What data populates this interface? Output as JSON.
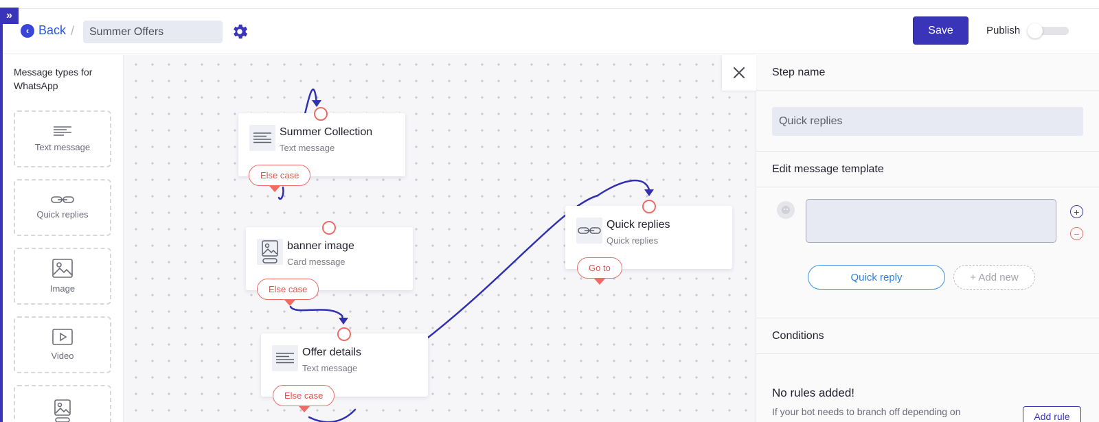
{
  "header": {
    "back_label": "Back",
    "separator": "/",
    "flow_name": "Summer Offers",
    "save_label": "Save",
    "publish_label": "Publish",
    "publish_enabled": false
  },
  "palette": {
    "title": "Message types for WhatsApp",
    "items": [
      {
        "label": "Text message",
        "icon": "text-lines-icon"
      },
      {
        "label": "Quick replies",
        "icon": "link-chain-icon"
      },
      {
        "label": "Image",
        "icon": "image-icon"
      },
      {
        "label": "Video",
        "icon": "video-play-icon"
      },
      {
        "label": "",
        "icon": "card-image-icon"
      }
    ]
  },
  "canvas": {
    "nodes": [
      {
        "title": "Summer Collection",
        "subtitle": "Text message",
        "case_label": "Else case",
        "icon": "text-lines-icon"
      },
      {
        "title": "banner image",
        "subtitle": "Card message",
        "case_label": "Else case",
        "icon": "card-image-icon"
      },
      {
        "title": "Offer details",
        "subtitle": "Text message",
        "case_label": "Else case",
        "icon": "text-lines-icon"
      },
      {
        "title": "Quick replies",
        "subtitle": "Quick replies",
        "case_label": "Go to",
        "icon": "link-chain-icon"
      }
    ]
  },
  "panel": {
    "step_name_heading": "Step name",
    "step_name_value": "Quick replies",
    "template_heading": "Edit message template",
    "template_text": "",
    "quick_reply_label": "Quick reply",
    "add_new_label": "+ Add new",
    "conditions_heading": "Conditions",
    "no_rules_title": "No rules added!",
    "no_rules_hint": "If your bot needs to branch off depending on",
    "add_rule_label": "Add rule"
  },
  "colors": {
    "primary": "#3a35b8",
    "accent_red": "#ee6b66",
    "link_blue": "#2b56e0",
    "canvas_bg": "#f6f6f9"
  }
}
